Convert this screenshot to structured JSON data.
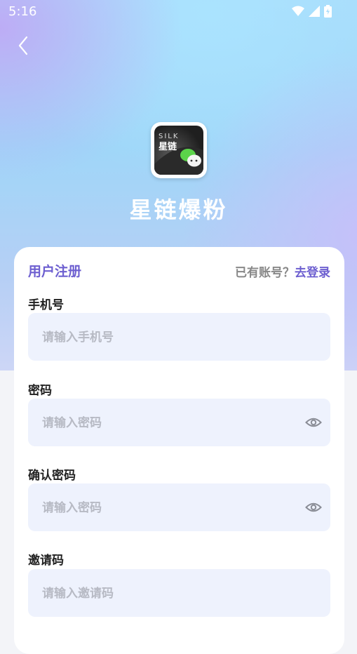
{
  "status_bar": {
    "time": "5:16"
  },
  "app": {
    "name": "星链爆粉",
    "logo_text": "SILK 星链"
  },
  "form": {
    "title": "用户注册",
    "login_prompt": "已有账号？",
    "login_link": "去登录",
    "fields": [
      {
        "label": "手机号",
        "placeholder": "请输入手机号"
      },
      {
        "label": "密码",
        "placeholder": "请输入密码",
        "icon": "eye-icon"
      },
      {
        "label": "确认密码",
        "placeholder": "请输入密码",
        "icon": "eye-icon"
      },
      {
        "label": "邀请码",
        "placeholder": "请输入邀请码"
      }
    ]
  },
  "colors": {
    "accent": "#6d5fd0",
    "input_bg": "#eef2fd"
  }
}
